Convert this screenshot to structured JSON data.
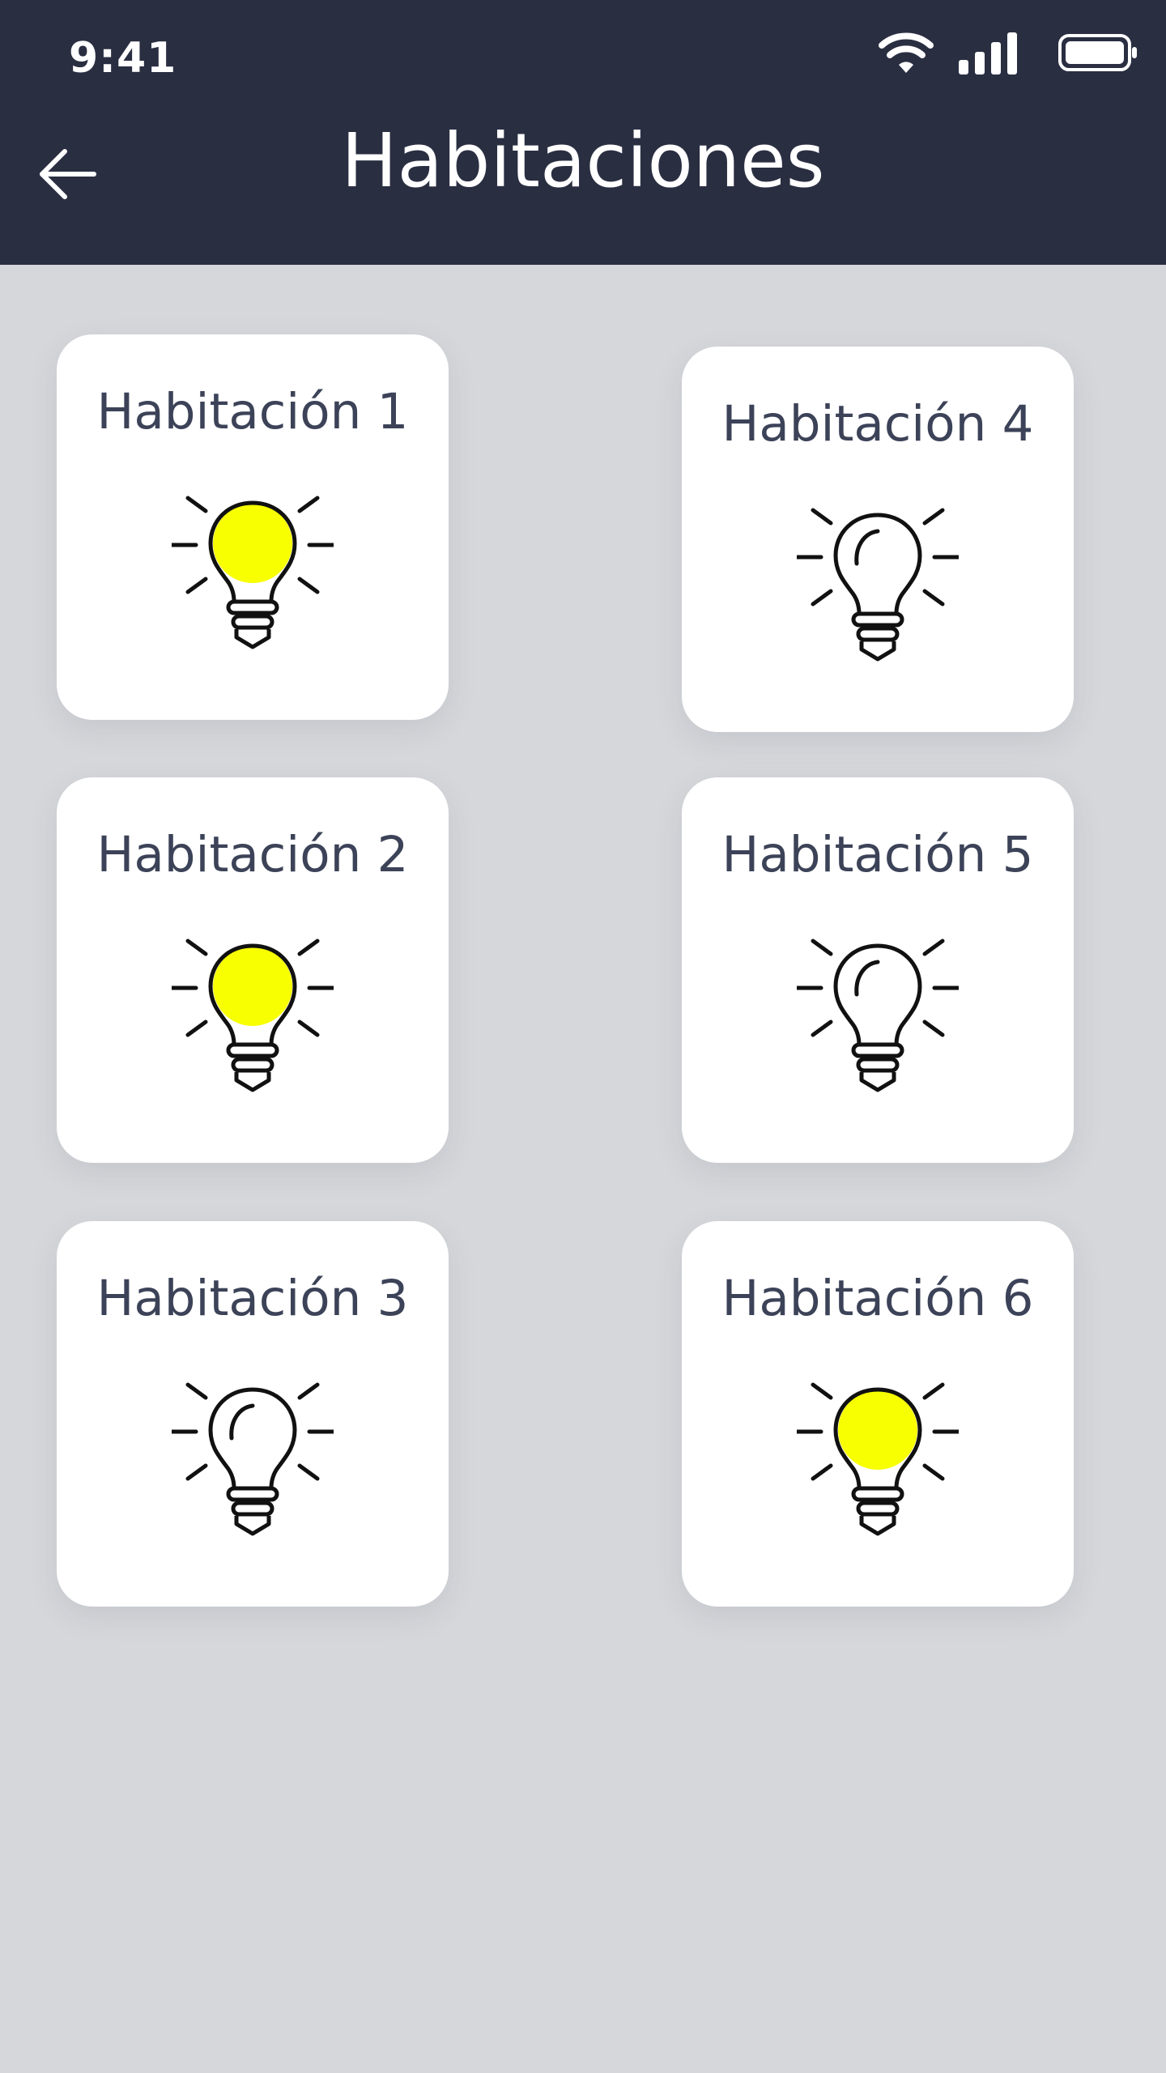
{
  "status_bar": {
    "time": "9:41",
    "icons": [
      "wifi-icon",
      "signal-icon",
      "battery-icon"
    ]
  },
  "header": {
    "title": "Habitaciones",
    "back_icon": "arrow-left-icon",
    "background_color": "#2a2e41"
  },
  "colors": {
    "page_background": "#d5d7db",
    "card_background": "#ffffff",
    "bulb_on": "#f7ff00",
    "card_text": "#3c4358"
  },
  "rooms": [
    {
      "name": "Habitación 1",
      "light": "on",
      "icon": "lightbulb-on-icon"
    },
    {
      "name": "Habitación 2",
      "light": "on",
      "icon": "lightbulb-on-icon"
    },
    {
      "name": "Habitación 3",
      "light": "off",
      "icon": "lightbulb-off-icon"
    },
    {
      "name": "Habitación 4",
      "light": "off",
      "icon": "lightbulb-off-icon"
    },
    {
      "name": "Habitación 5",
      "light": "off",
      "icon": "lightbulb-off-icon"
    },
    {
      "name": "Habitación 6",
      "light": "on",
      "icon": "lightbulb-on-icon"
    }
  ]
}
